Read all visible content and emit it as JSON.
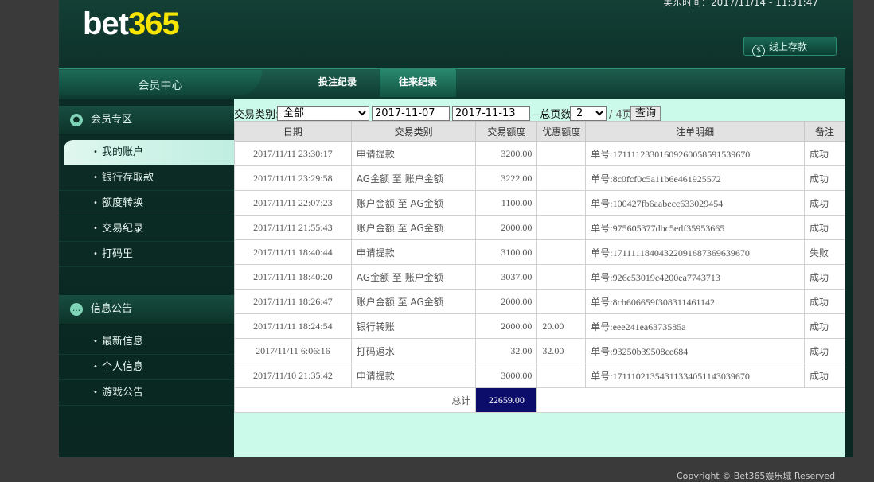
{
  "header": {
    "logo_white": "bet",
    "logo_yellow": "365",
    "time_label": "美东时间：",
    "time_value": "2017/11/14 - 11:31:47",
    "deposit_icon": "$",
    "deposit_label": "线上存款"
  },
  "nav": {
    "member_center": "会员中心",
    "tabs": [
      "投注纪录",
      "往来纪录"
    ],
    "active_tab": "往来纪录"
  },
  "sidebar": {
    "section1": {
      "title": "会员专区",
      "icon": "user-icon",
      "items": [
        "我的账户",
        "银行存取款",
        "额度转换",
        "交易纪录",
        "打码里"
      ]
    },
    "section2": {
      "title": "信息公告",
      "icon": "chat-icon",
      "items": [
        "最新信息",
        "个人信息",
        "游戏公告"
      ]
    },
    "active_item": "我的账户"
  },
  "filter": {
    "type_label": "交易类别:",
    "type_value": "全部",
    "date_from": "2017-11-07",
    "date_to": "2017-11-13",
    "pages_label": "--总页数",
    "page_value": "2",
    "pages_total": "/ 4页",
    "query_button": "查询"
  },
  "table": {
    "headers": [
      "日期",
      "交易类别",
      "交易额度",
      "优惠额度",
      "注单明细",
      "备注"
    ],
    "rows": [
      [
        "2017/11/11 23:30:17",
        "申请提款",
        "3200.00",
        "",
        "单号:17111123301609260058591539670",
        "成功"
      ],
      [
        "2017/11/11 23:29:58",
        "AG金额 至 账户金额",
        "3222.00",
        "",
        "单号:8c0fcf0c5a11b6e461925572",
        "成功"
      ],
      [
        "2017/11/11 22:07:23",
        "账户金额 至 AG金额",
        "1100.00",
        "",
        "单号:100427fb6aabecc633029454",
        "成功"
      ],
      [
        "2017/11/11 21:55:43",
        "账户金额 至 AG金额",
        "2000.00",
        "",
        "单号:975605377dbc5edf35953665",
        "成功"
      ],
      [
        "2017/11/11 18:40:44",
        "申请提款",
        "3100.00",
        "",
        "单号:17111118404322091687369639670",
        "失败"
      ],
      [
        "2017/11/11 18:40:20",
        "AG金额 至 账户金额",
        "3037.00",
        "",
        "单号:926e53019c4200ea7743713",
        "成功"
      ],
      [
        "2017/11/11 18:26:47",
        "账户金额 至 AG金额",
        "2000.00",
        "",
        "单号:8cb606659f308311461142",
        "成功"
      ],
      [
        "2017/11/11 18:24:54",
        "银行转账",
        "2000.00",
        "20.00",
        "单号:eee241ea6373585a",
        "成功"
      ],
      [
        "2017/11/11 6:06:16",
        "打码返水",
        "32.00",
        "32.00",
        "单号:93250b39508ce684",
        "成功"
      ],
      [
        "2017/11/10 21:35:42",
        "申请提款",
        "3000.00",
        "",
        "单号:17111021354311334051143039670",
        "成功"
      ]
    ],
    "total_label": "总计",
    "total_value": "22659.00"
  },
  "footer": {
    "copyright": "Copyright © Bet365娱乐城 Reserved"
  },
  "colors": {
    "frame": "#0b2c25",
    "content_bg": "#ccfaea",
    "logo_yellow": "#f7e400",
    "total_bg": "#0c0c6a"
  }
}
